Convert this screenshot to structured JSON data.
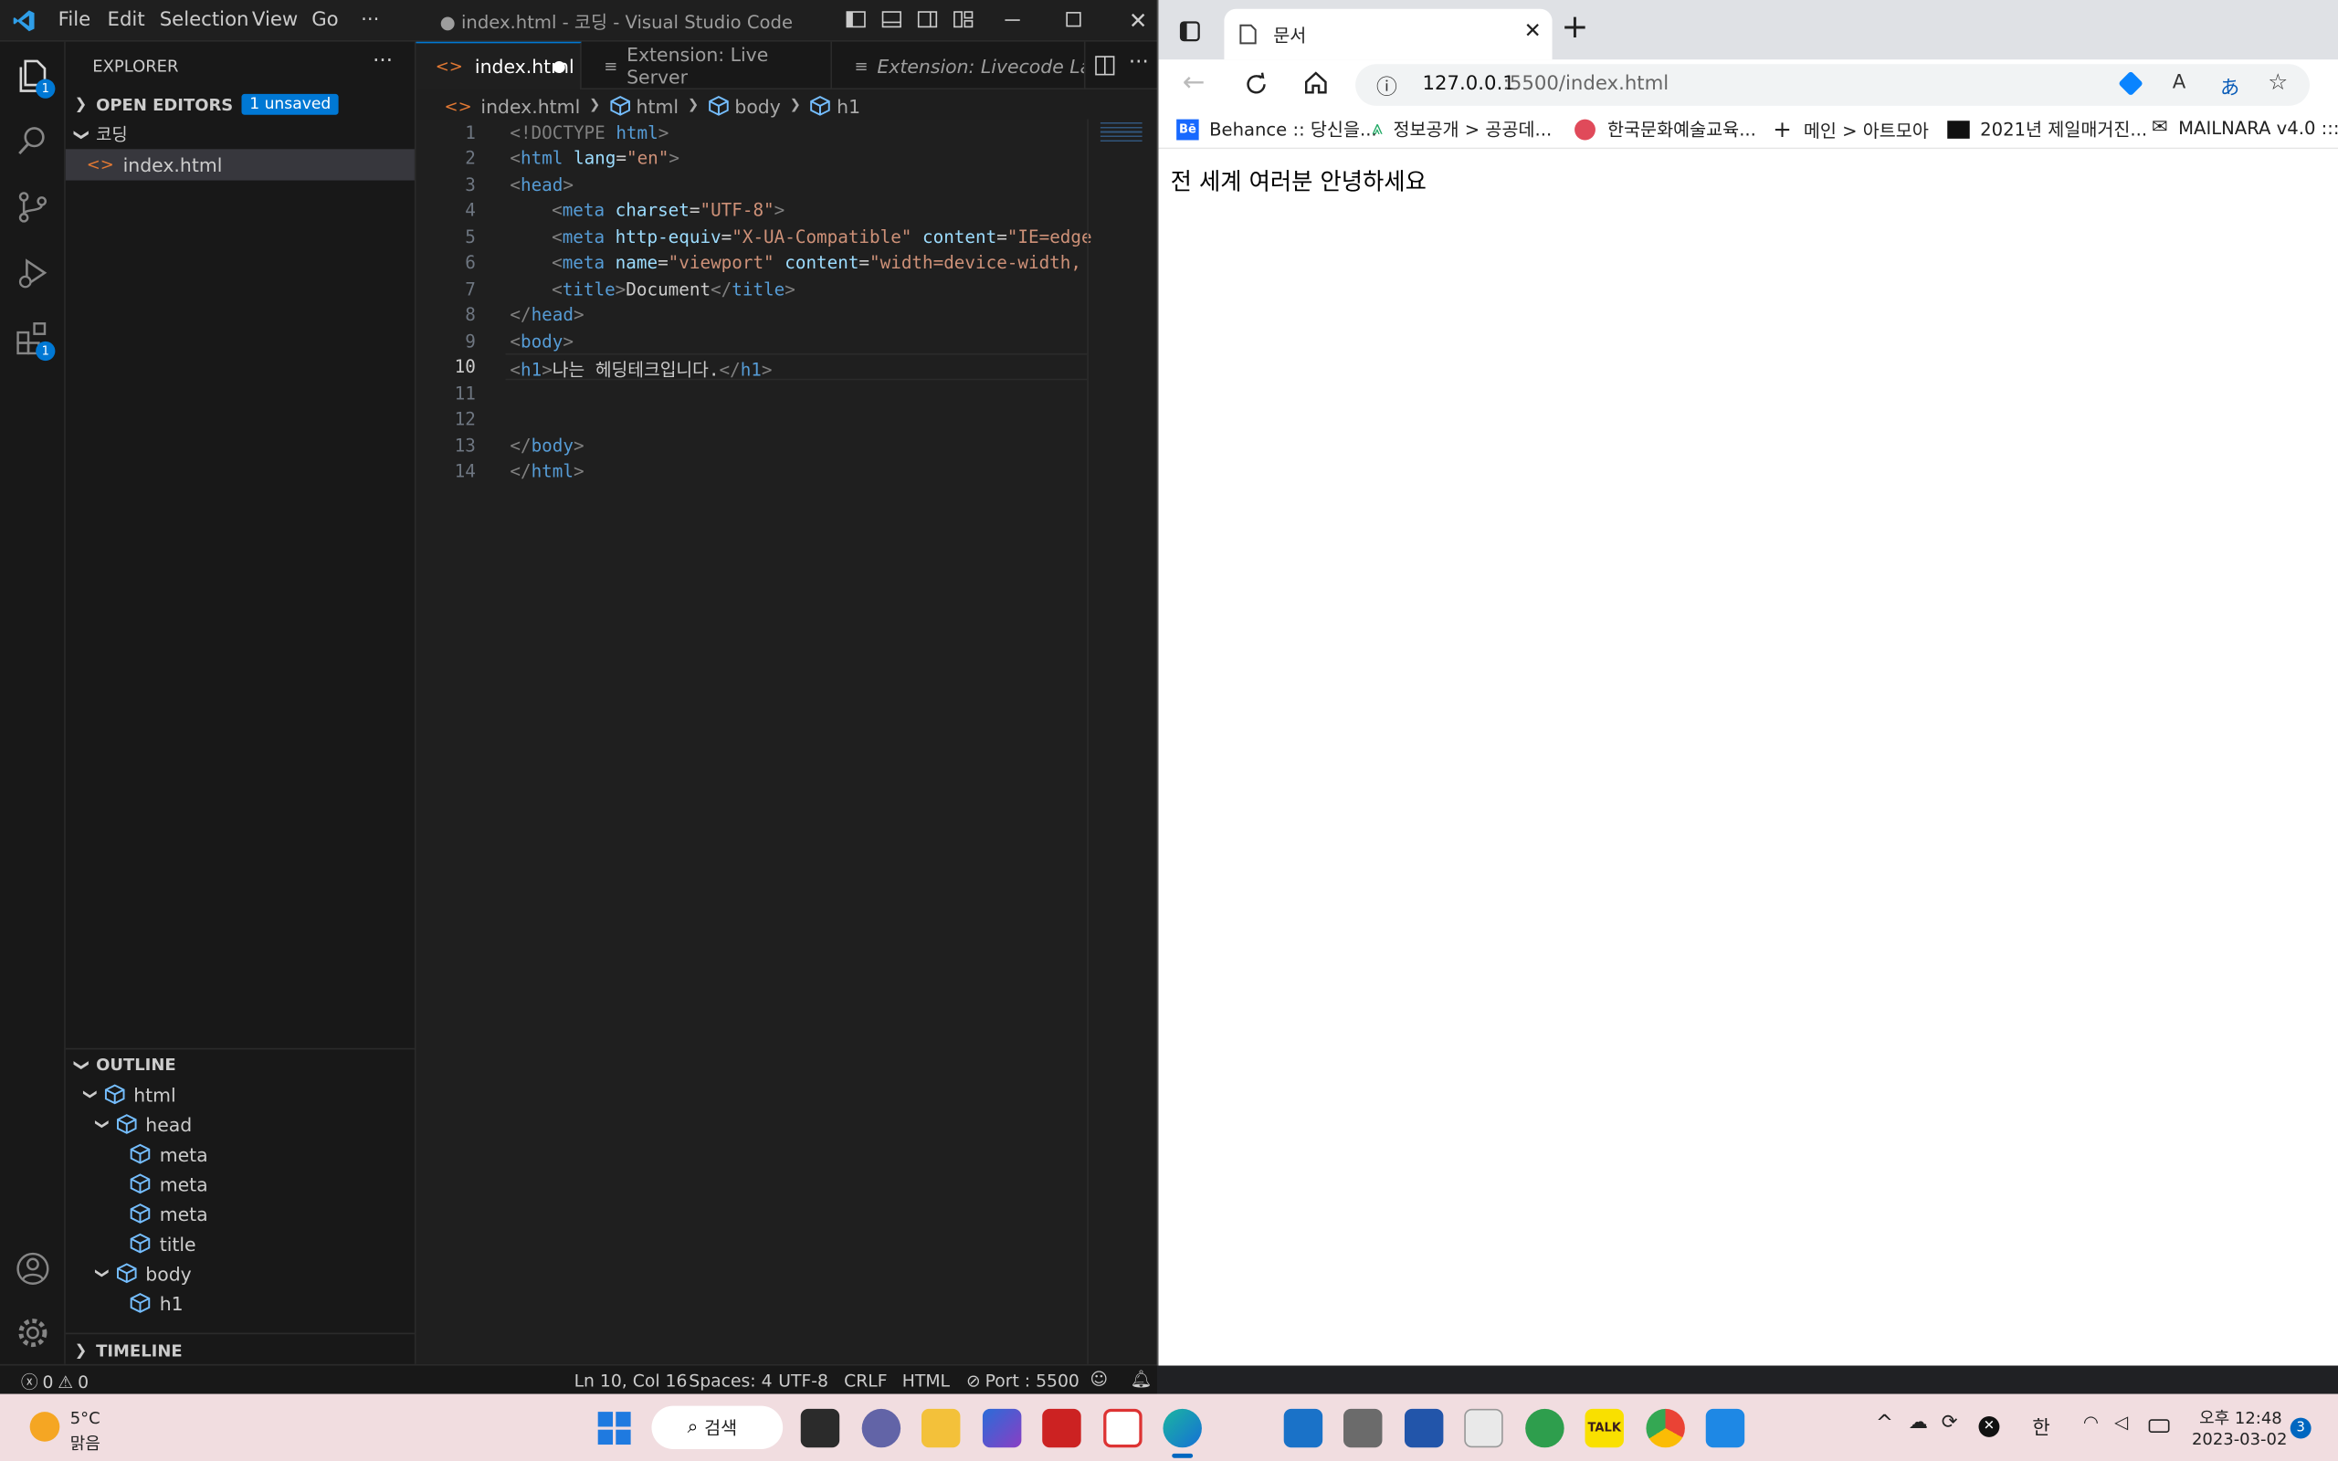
{
  "vscode": {
    "window_title": "● index.html - 코딩 - Visual Studio Code",
    "menu": [
      "File",
      "Edit",
      "Selection",
      "View",
      "Go",
      "···"
    ],
    "activity_badges": {
      "explorer": "1",
      "extensions": "1"
    },
    "sidebar": {
      "title": "EXPLORER",
      "more": "···",
      "open_editors": "OPEN EDITORS",
      "unsaved_badge": "1 unsaved",
      "folder": "코딩",
      "file": "index.html",
      "outline_title": "OUTLINE",
      "outline": [
        "html",
        "head",
        "meta",
        "meta",
        "meta",
        "title",
        "body",
        "h1"
      ],
      "timeline_title": "TIMELINE"
    },
    "tabs": [
      {
        "label": "index.html",
        "modified": true
      },
      {
        "label": "Extension: Live Server"
      },
      {
        "label": "Extension: Livecode Langu"
      }
    ],
    "breadcrumb": [
      "index.html",
      "html",
      "body",
      "h1"
    ],
    "line_numbers": [
      "1",
      "2",
      "3",
      "4",
      "5",
      "6",
      "7",
      "8",
      "9",
      "10",
      "11",
      "12",
      "13",
      "14"
    ],
    "code": {
      "l1": [
        "<!DOCTYPE",
        " html",
        ">"
      ],
      "l2": [
        "<",
        "html",
        " lang",
        "=",
        "\"en\"",
        ">"
      ],
      "l3": [
        "<",
        "head",
        ">"
      ],
      "l4": [
        "<",
        "meta",
        " charset",
        "=",
        "\"UTF-8\"",
        ">"
      ],
      "l5": [
        "<",
        "meta",
        " http-equiv",
        "=",
        "\"X-UA-Compatible\"",
        " content",
        "=",
        "\"IE=edge"
      ],
      "l6": [
        "<",
        "meta",
        " name",
        "=",
        "\"viewport\"",
        " content",
        "=",
        "\"width=device-width,"
      ],
      "l7": [
        "<",
        "title",
        ">",
        "Document",
        "</",
        "title",
        ">"
      ],
      "l8": [
        "</",
        "head",
        ">"
      ],
      "l9": [
        "<",
        "body",
        ">"
      ],
      "l10": [
        "<",
        "h1",
        ">",
        "나는 헤딩테크입니다.",
        "</",
        "h1",
        ">"
      ],
      "l13": [
        "</",
        "body",
        ">"
      ],
      "l14": [
        "</",
        "html",
        ">"
      ]
    },
    "status": {
      "errors": "0",
      "warnings": "0",
      "position": "Ln 10, Col 16",
      "spaces": "Spaces: 4",
      "encoding": "UTF-8",
      "eol": "CRLF",
      "language": "HTML",
      "port": "Port : 5500"
    }
  },
  "browser": {
    "tab_title": "문서",
    "url_host": "127.0.0.1",
    "url_rest": ":5500/index.html",
    "bookmarks": [
      "Behance :: 당신을...",
      "정보공개 > 공공데...",
      "한국문화예술교육...",
      "메인 > 아트모아",
      "2021년 제일매거진...",
      "MAILNARA v4.0 :::..."
    ],
    "page_text": "전 세계 여러분 안녕하세요"
  },
  "taskbar": {
    "weather_temp": "5°C",
    "weather_desc": "맑음",
    "search": "검색",
    "ime": "한",
    "time": "오후 12:48",
    "date": "2023-03-02",
    "notification_count": "3"
  },
  "colors": {
    "vscode_bg": "#1e1e1e",
    "accent": "#0078d4",
    "taskbar": "#f1dde0"
  }
}
